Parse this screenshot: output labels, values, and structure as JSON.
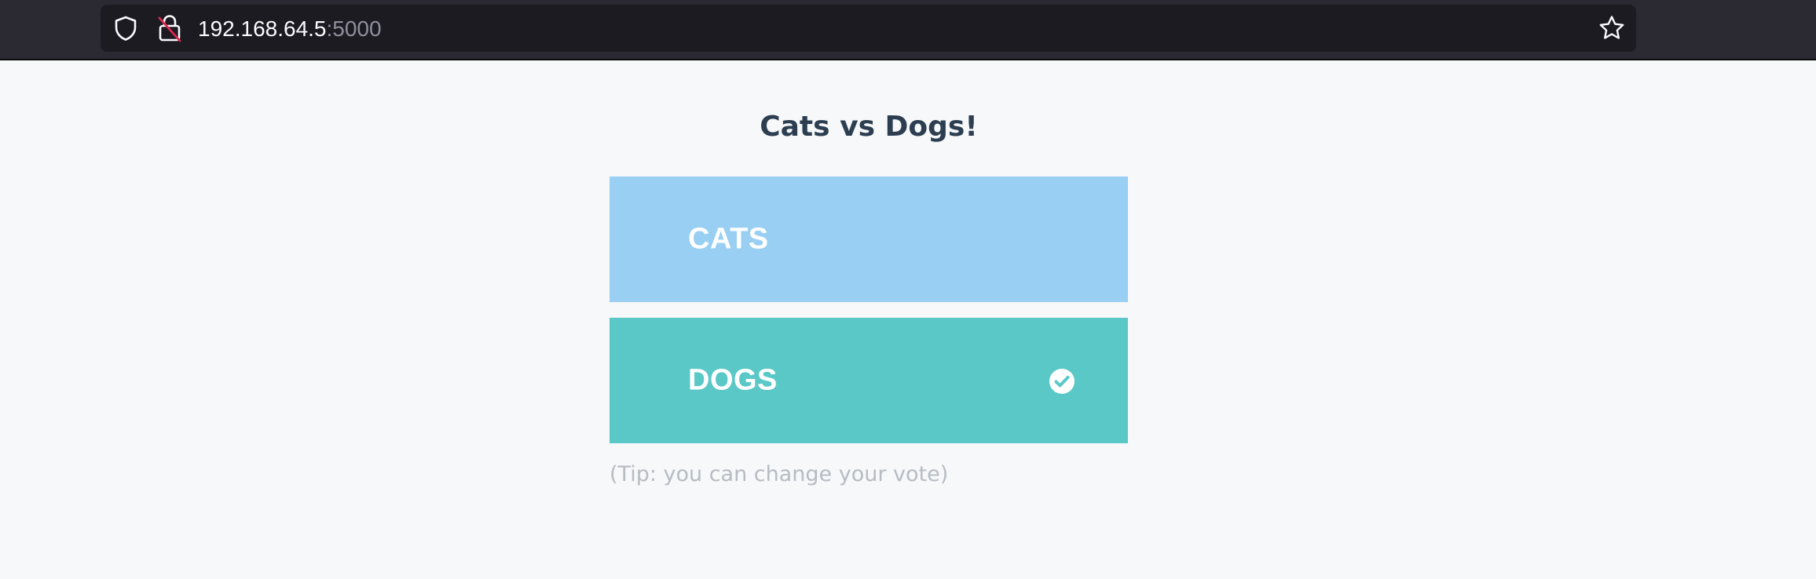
{
  "browser": {
    "url_host": "192.168.64.5",
    "url_port": ":5000",
    "icons": [
      "shield-icon",
      "insecure-lock-icon",
      "star-icon"
    ]
  },
  "page": {
    "title": "Cats vs Dogs!",
    "options": [
      {
        "label": "CATS",
        "color": "#98cff3",
        "selected": false
      },
      {
        "label": "DOGS",
        "color": "#5bc8c8",
        "selected": true,
        "selected_icon": "check-circle-icon"
      }
    ],
    "tip": "(Tip: you can change your vote)"
  },
  "colors": {
    "background": "#f6f8fa",
    "title": "#2c3e50",
    "tip": "#b7bcc2",
    "browser_chrome": "#2b2a33",
    "url_field": "#1c1b22"
  }
}
